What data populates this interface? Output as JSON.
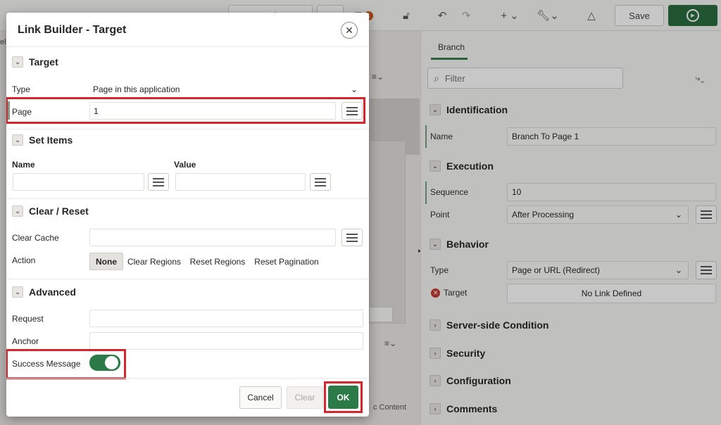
{
  "toolbar": {
    "save_label": "Save",
    "badge_count": "1",
    "icons": [
      "page-selector-icon",
      "lock-icon",
      "undo-icon",
      "redo-icon",
      "add-icon",
      "wrench-icon",
      "shapes-icon",
      "run-icon"
    ]
  },
  "right_pane": {
    "tab_label": "Branch",
    "filter_placeholder": "Filter",
    "sections": {
      "identification": "Identification",
      "execution": "Execution",
      "behavior": "Behavior",
      "server_side": "Server-side Condition",
      "security": "Security",
      "configuration": "Configuration",
      "comments": "Comments"
    },
    "fields": {
      "name_label": "Name",
      "name_value": "Branch To Page 1",
      "sequence_label": "Sequence",
      "sequence_value": "10",
      "point_label": "Point",
      "point_value": "After Processing",
      "type_label": "Type",
      "type_value": "Page or URL (Redirect)",
      "target_label": "Target",
      "target_value": "No Link Defined"
    }
  },
  "background": {
    "partial_text": "c Content",
    "edge_letters": [
      "el",
      "o"
    ]
  },
  "dialog": {
    "title": "Link Builder - Target",
    "sections": {
      "target": "Target",
      "set_items": "Set Items",
      "clear_reset": "Clear / Reset",
      "advanced": "Advanced"
    },
    "target": {
      "type_label": "Type",
      "type_value": "Page in this application",
      "page_label": "Page",
      "page_value": "1"
    },
    "set_items": {
      "name_header": "Name",
      "value_header": "Value",
      "name_value": "",
      "value_value": ""
    },
    "clear_reset": {
      "clear_cache_label": "Clear Cache",
      "clear_cache_value": "",
      "action_label": "Action",
      "actions": [
        "None",
        "Clear Regions",
        "Reset Regions",
        "Reset Pagination"
      ],
      "selected_action": "None"
    },
    "advanced": {
      "request_label": "Request",
      "request_value": "",
      "anchor_label": "Anchor",
      "anchor_value": "",
      "success_message_label": "Success Message",
      "success_message_on": true
    },
    "footer": {
      "cancel_label": "Cancel",
      "clear_label": "Clear",
      "ok_label": "OK"
    }
  },
  "colors": {
    "accent_green": "#2b7a47",
    "highlight_red": "#d7252d",
    "error_red": "#c63a33"
  }
}
